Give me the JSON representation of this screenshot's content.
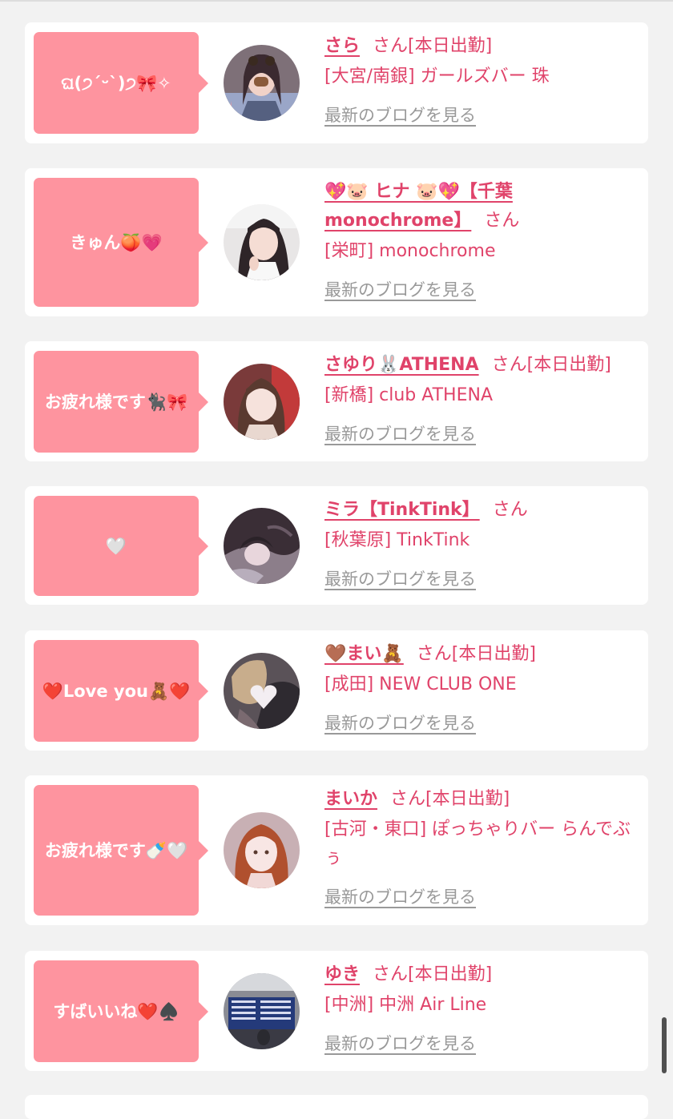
{
  "blog_link_label": "最新のブログを見る",
  "colors": {
    "bubble": "#fe949f",
    "accent": "#e0436a",
    "muted": "#999999",
    "background": "#f2f2f2"
  },
  "entries": [
    {
      "message": "ଘ(੭ˊᵕˋ)੭🎀✧",
      "name": "さら",
      "suffix": "さん[本日出勤]",
      "shop": "[大宮/南銀] ガールズバー 珠",
      "avatar": "avatar-photo-1"
    },
    {
      "message": "きゅん🍑💗",
      "name": "💖🐷 ヒナ 🐷💖【千葉monochrome】",
      "suffix": "さん",
      "shop": "[栄町] monochrome",
      "avatar": "avatar-photo-2"
    },
    {
      "message": "お疲れ様です🐈‍⬛🎀",
      "name": "さゆり🐰ATHENA",
      "suffix": "さん[本日出勤]",
      "shop": "[新橋] club ATHENA",
      "avatar": "avatar-photo-3"
    },
    {
      "message": "🤍",
      "name": "ミラ【TinkTink】",
      "suffix": "さん",
      "shop": "[秋葉原] TinkTink",
      "avatar": "avatar-photo-4"
    },
    {
      "message": "❤️Love you🧸❤️",
      "name": "🤎まい🧸",
      "suffix": "さん[本日出勤]",
      "shop": "[成田] NEW CLUB ONE",
      "avatar": "avatar-photo-5"
    },
    {
      "message": "お疲れ様です🍼🤍",
      "name": "まいか",
      "suffix": "さん[本日出勤]",
      "shop": "[古河・東口] ぽっちゃりバー らんでぶぅ",
      "avatar": "avatar-photo-6"
    },
    {
      "message": "すばいいね❤️♠️",
      "name": "ゆき",
      "suffix": "さん[本日出勤]",
      "shop": "[中洲] 中洲 Air Line",
      "avatar": "avatar-photo-7"
    }
  ]
}
